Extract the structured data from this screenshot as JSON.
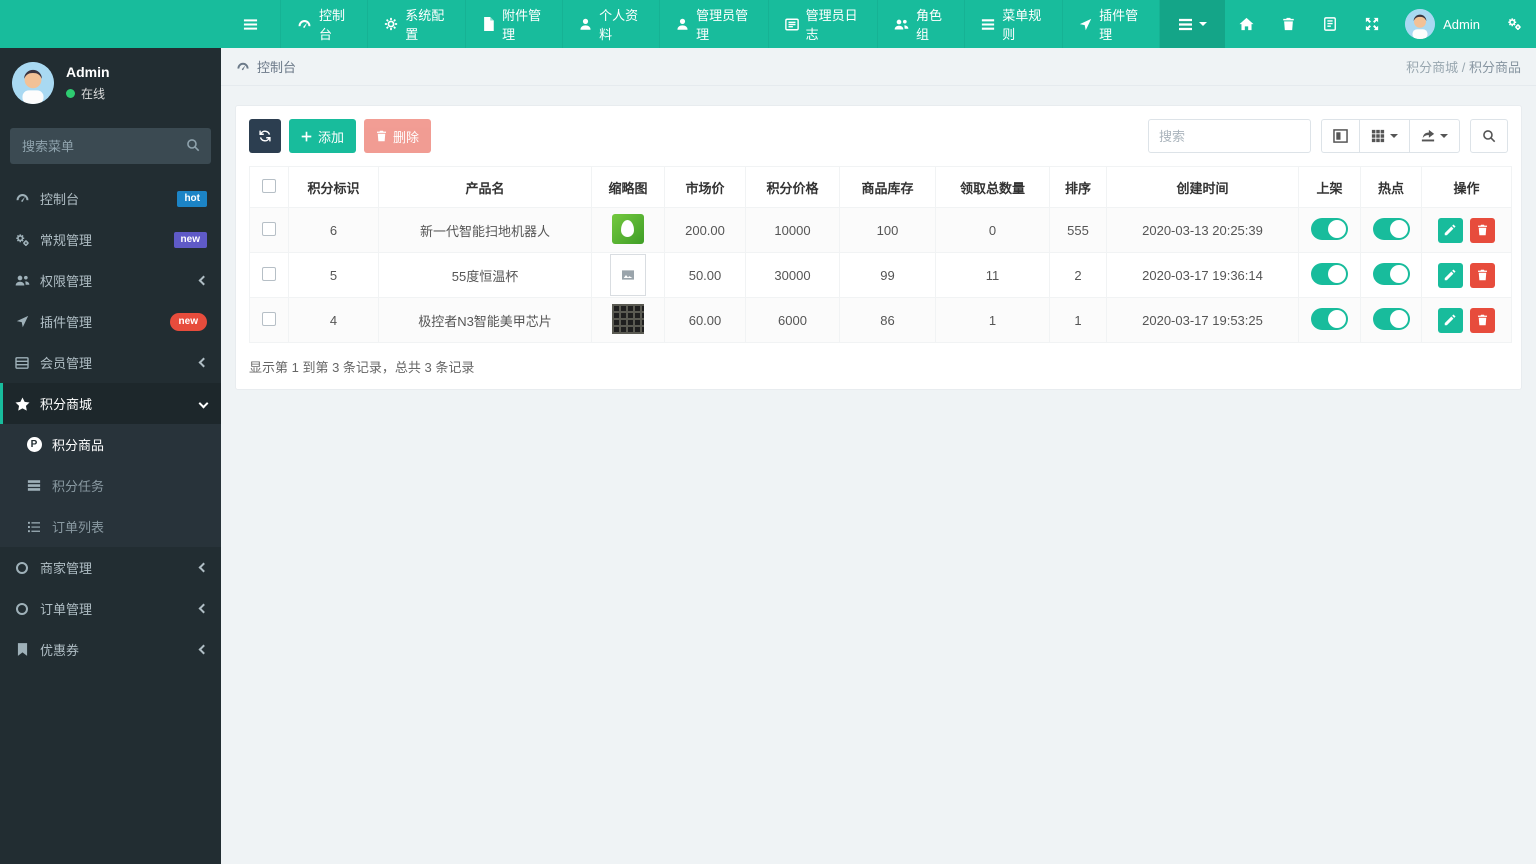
{
  "navbar": {
    "menu": [
      {
        "icon": "dashboard-icon",
        "label": "控制台"
      },
      {
        "icon": "gear-icon",
        "label": "系统配置"
      },
      {
        "icon": "file-icon",
        "label": "附件管理"
      },
      {
        "icon": "user-icon",
        "label": "个人资料"
      },
      {
        "icon": "admin-icon",
        "label": "管理员管理"
      },
      {
        "icon": "log-icon",
        "label": "管理员日志"
      },
      {
        "icon": "users-icon",
        "label": "角色组"
      },
      {
        "icon": "list-icon",
        "label": "菜单规则"
      },
      {
        "icon": "plugin-icon",
        "label": "插件管理"
      }
    ],
    "right_icons": [
      "list-dropdown-icon",
      "home-icon",
      "trash-icon",
      "docs-icon",
      "fullscreen-icon",
      "gears-icon"
    ],
    "username": "Admin"
  },
  "sidebar": {
    "user": {
      "name": "Admin",
      "status": "在线"
    },
    "search_placeholder": "搜索菜单",
    "items": [
      {
        "icon": "dashboard-icon",
        "label": "控制台",
        "badge": "hot",
        "badge_color": "#1c84c6"
      },
      {
        "icon": "gears-icon",
        "label": "常规管理",
        "badge": "new",
        "badge_color": "#5f5ac7"
      },
      {
        "icon": "users-icon",
        "label": "权限管理",
        "arrow": "left"
      },
      {
        "icon": "plugin-icon",
        "label": "插件管理",
        "badge": "new",
        "badge_color": "#e74c3c"
      },
      {
        "icon": "list-icon",
        "label": "会员管理",
        "arrow": "left"
      },
      {
        "icon": "star-icon",
        "label": "积分商城",
        "arrow": "down",
        "active": true
      }
    ],
    "submenu": [
      {
        "icon": "circle-p-icon",
        "label": "积分商品",
        "active": true
      },
      {
        "icon": "tasks-icon",
        "label": "积分任务",
        "active": false
      },
      {
        "icon": "list-ol-icon",
        "label": "订单列表",
        "active": false
      }
    ],
    "items_bottom": [
      {
        "icon": "circle-o-icon",
        "label": "商家管理",
        "arrow": "left"
      },
      {
        "icon": "circle-o-icon",
        "label": "订单管理",
        "arrow": "left"
      },
      {
        "icon": "bookmark-icon",
        "label": "优惠券",
        "arrow": "left"
      }
    ]
  },
  "breadcrumb": {
    "left": "控制台",
    "parent": "积分商城",
    "sep": "/",
    "current": "积分商品"
  },
  "toolbar": {
    "add_label": "添加",
    "delete_label": "删除",
    "search_placeholder": "搜索"
  },
  "table": {
    "headers": [
      "积分标识",
      "产品名",
      "缩略图",
      "市场价",
      "积分价格",
      "商品库存",
      "领取总数量",
      "排序",
      "创建时间",
      "上架",
      "热点",
      "操作"
    ],
    "rows": [
      {
        "id": "6",
        "name": "新一代智能扫地机器人",
        "thumb": "green-product-image",
        "market_price": "200.00",
        "score_price": "10000",
        "stock": "100",
        "received": "0",
        "sort": "555",
        "created": "2020-03-13 20:25:39",
        "on_shelf": true,
        "hot": true
      },
      {
        "id": "5",
        "name": "55度恒温杯",
        "thumb": "broken-image",
        "market_price": "50.00",
        "score_price": "30000",
        "stock": "99",
        "received": "11",
        "sort": "2",
        "created": "2020-03-17 19:36:14",
        "on_shelf": true,
        "hot": true
      },
      {
        "id": "4",
        "name": "极控者N3智能美甲芯片",
        "thumb": "dark-chip-image",
        "market_price": "60.00",
        "score_price": "6000",
        "stock": "86",
        "received": "1",
        "sort": "1",
        "created": "2020-03-17 19:53:25",
        "on_shelf": true,
        "hot": true
      }
    ],
    "footer": "显示第 1 到第 3 条记录，总共 3 条记录"
  },
  "colors": {
    "accent": "#18bc9c",
    "navbar": "#18bc9c",
    "sidebar": "#222d32",
    "danger": "#e74c3c",
    "badge_hot": "#1c84c6",
    "badge_new_purple": "#5f5ac7",
    "badge_new_red": "#e74c3c",
    "online_dot": "#2ecc71"
  }
}
